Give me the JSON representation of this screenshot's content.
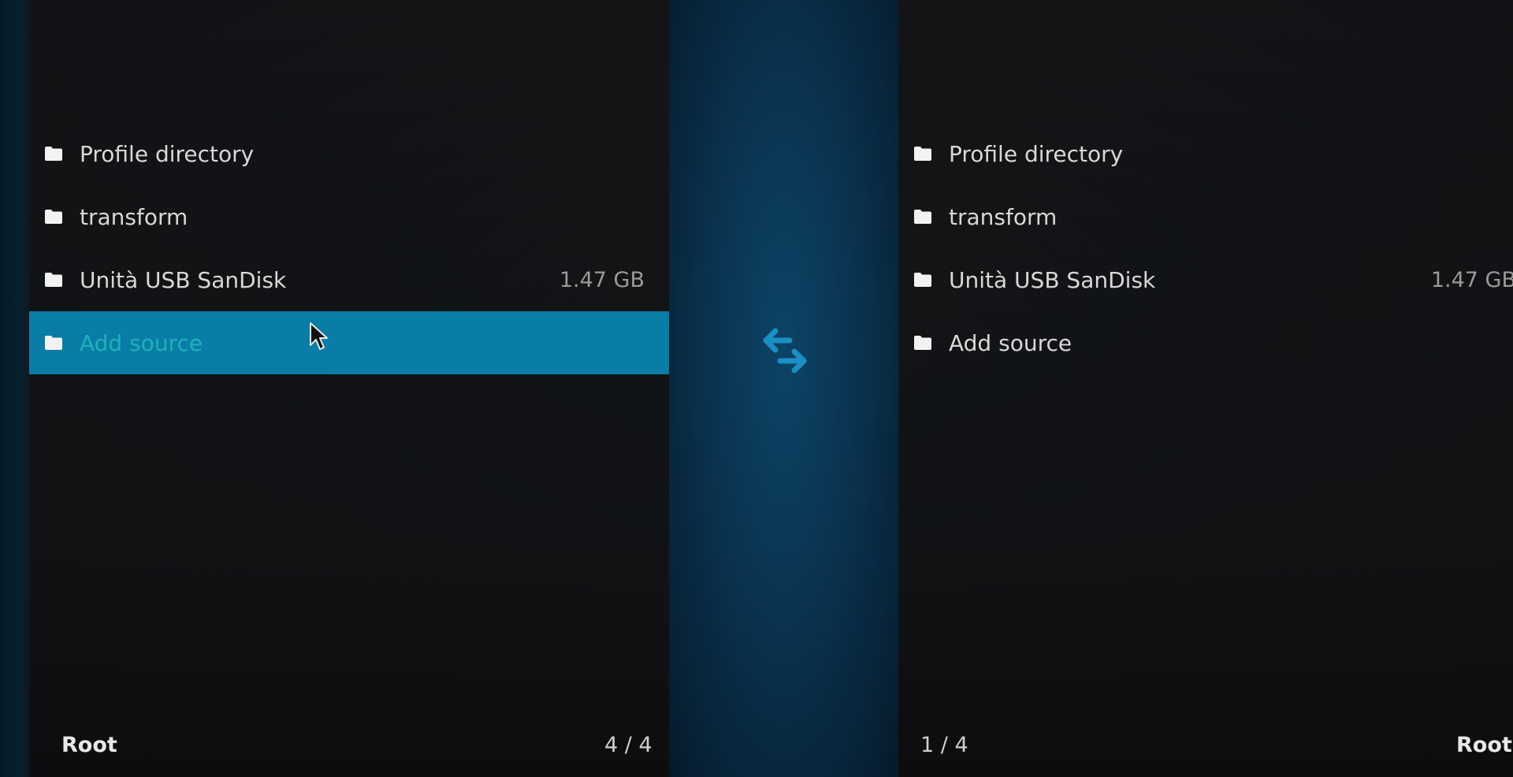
{
  "left_pane": {
    "items": [
      {
        "label": "Profile directory",
        "size": ""
      },
      {
        "label": "transform",
        "size": ""
      },
      {
        "label": "Unità USB SanDisk",
        "size": "1.47 GB"
      },
      {
        "label": "Add source",
        "size": ""
      }
    ],
    "path": "Root",
    "count": "4 / 4"
  },
  "right_pane": {
    "items": [
      {
        "label": "Profile directory",
        "size": ""
      },
      {
        "label": "transform",
        "size": ""
      },
      {
        "label": "Unità USB SanDisk",
        "size": "1.47 GB"
      },
      {
        "label": "Add source",
        "size": ""
      }
    ],
    "path": "Root",
    "count": "1 / 4"
  },
  "icons": {
    "item": "folder-icon",
    "swap": "swap-arrows-icon",
    "pointer": "mouse-cursor-icon"
  },
  "colors": {
    "accent": "#0a7da6",
    "selected_text": "#1fb0ba",
    "swap_icon": "#1a8fc4"
  }
}
